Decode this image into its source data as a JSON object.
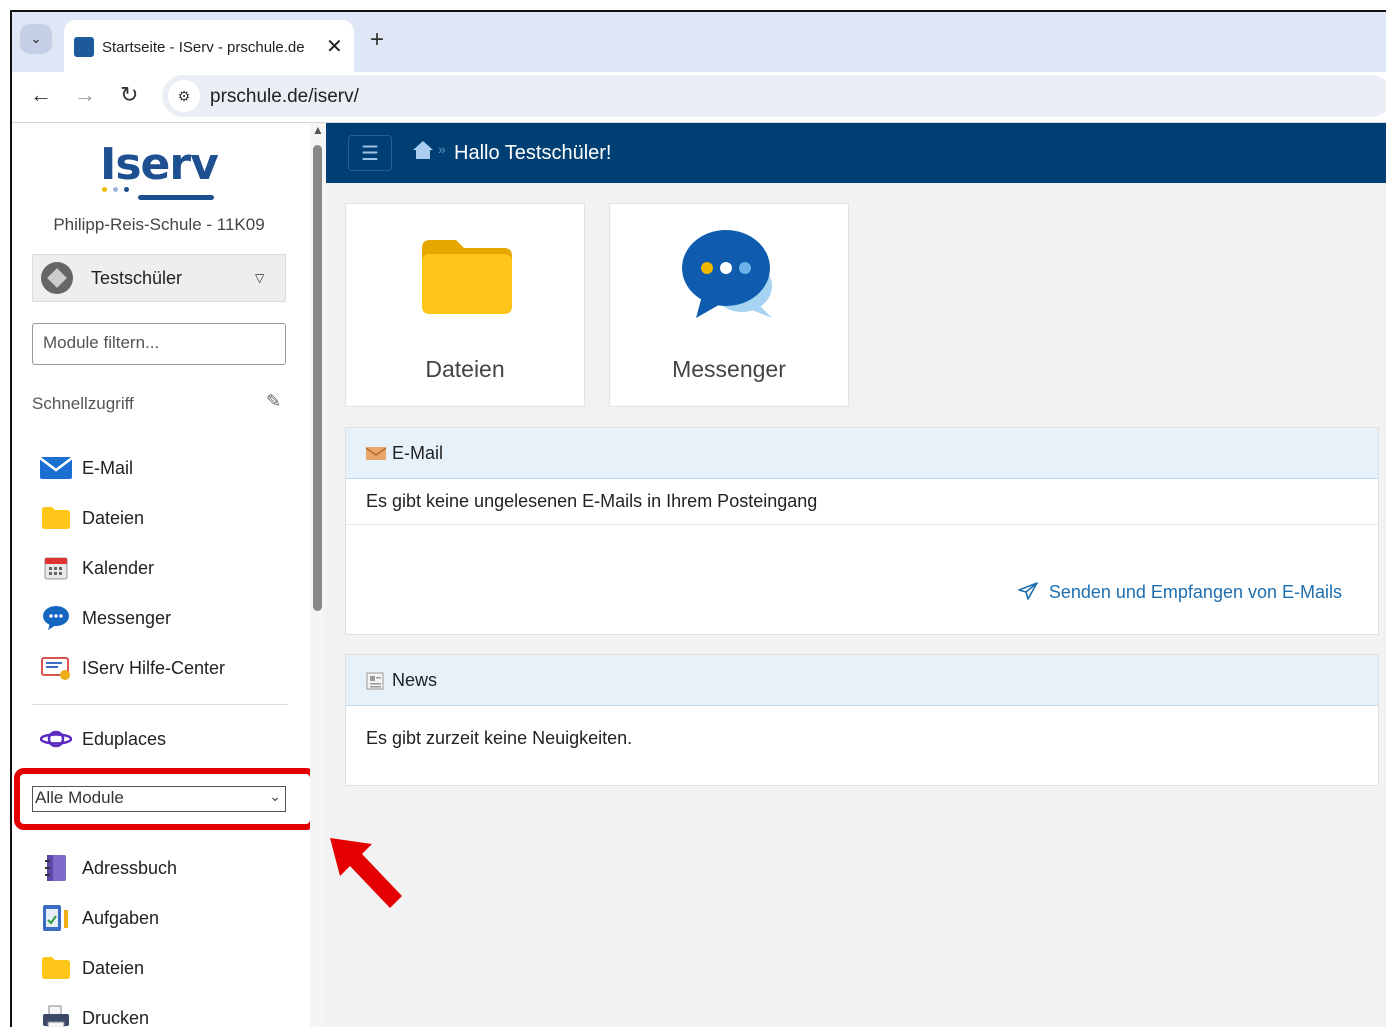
{
  "browser": {
    "tab_title": "Startseite - IServ - prschule.de",
    "url": "prschule.de/iserv/"
  },
  "sidebar": {
    "logo_text": "Iserv",
    "school": "Philipp-Reis-Schule - 11K09",
    "user": "Testschüler",
    "filter_placeholder": "Module filtern...",
    "quick_access_title": "Schnellzugriff",
    "quick_access": [
      {
        "label": "E-Mail",
        "icon": "mail-icon"
      },
      {
        "label": "Dateien",
        "icon": "folder-icon"
      },
      {
        "label": "Kalender",
        "icon": "calendar-icon"
      },
      {
        "label": "Messenger",
        "icon": "messenger-icon"
      },
      {
        "label": "IServ Hilfe-Center",
        "icon": "help-center-icon"
      }
    ],
    "extra_item": {
      "label": "Eduplaces",
      "icon": "planet-icon"
    },
    "module_select": "Alle Module",
    "modules": [
      {
        "label": "Adressbuch",
        "icon": "addressbook-icon"
      },
      {
        "label": "Aufgaben",
        "icon": "tasks-icon"
      },
      {
        "label": "Dateien",
        "icon": "folder-icon"
      },
      {
        "label": "Drucken",
        "icon": "printer-icon"
      }
    ]
  },
  "header": {
    "greeting": "Hallo Testschüler!",
    "separator": "»"
  },
  "tiles": [
    {
      "label": "Dateien",
      "icon": "folder-icon"
    },
    {
      "label": "Messenger",
      "icon": "messenger-icon"
    }
  ],
  "email_panel": {
    "title": "E-Mail",
    "message": "Es gibt keine ungelesenen E-Mails in Ihrem Posteingang",
    "link": "Senden und Empfangen von E-Mails"
  },
  "news_panel": {
    "title": "News",
    "message": "Es gibt zurzeit keine Neuigkeiten."
  },
  "colors": {
    "header": "#003f73",
    "brand": "#1d4f91",
    "highlight": "#e40000",
    "link": "#1e6fb0"
  }
}
